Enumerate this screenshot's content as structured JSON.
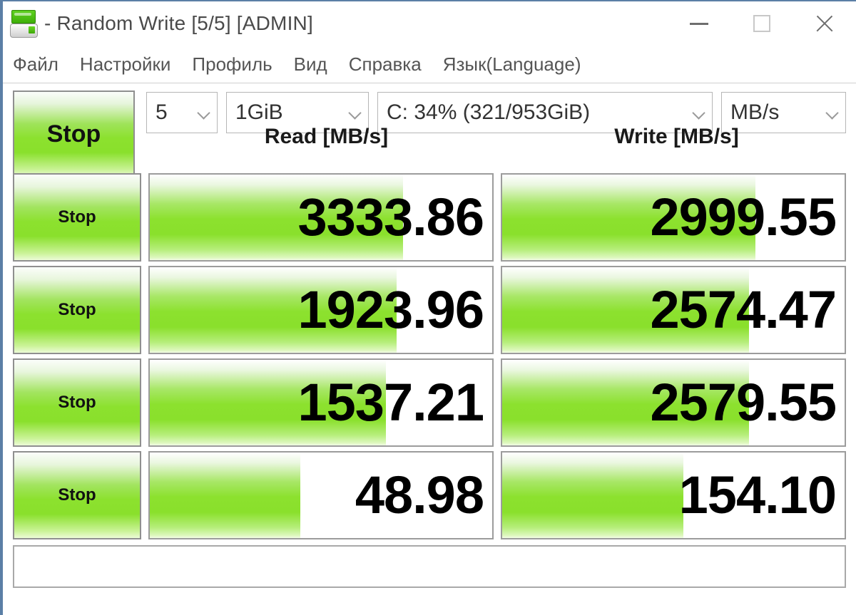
{
  "window": {
    "title": "- Random Write [5/5] [ADMIN]",
    "icon": "crystaldiskmark-icon",
    "controls": {
      "minimize": "minimize-icon",
      "maximize": "maximize-icon",
      "close": "close-icon"
    }
  },
  "menu": {
    "items": [
      {
        "label": "Файл"
      },
      {
        "label": "Настройки"
      },
      {
        "label": "Профиль"
      },
      {
        "label": "Вид"
      },
      {
        "label": "Справка"
      },
      {
        "label": "Язык(Language)"
      }
    ]
  },
  "toolbar": {
    "all_button_label": "Stop",
    "combos": {
      "count": "5",
      "size": "1GiB",
      "drive": "C: 34% (321/953GiB)",
      "unit": "MB/s"
    }
  },
  "columns": {
    "read_header": "Read [MB/s]",
    "write_header": "Write [MB/s]"
  },
  "rows": [
    {
      "button": "Stop",
      "read": "3333.86",
      "write": "2999.55",
      "read_fill_pct": 74,
      "write_fill_pct": 74
    },
    {
      "button": "Stop",
      "read": "1923.96",
      "write": "2574.47",
      "read_fill_pct": 72,
      "write_fill_pct": 72
    },
    {
      "button": "Stop",
      "read": "1537.21",
      "write": "2579.55",
      "read_fill_pct": 69,
      "write_fill_pct": 72
    },
    {
      "button": "Stop",
      "read": "48.98",
      "write": "154.10",
      "read_fill_pct": 44,
      "write_fill_pct": 53
    }
  ],
  "status": {
    "text": ""
  },
  "colors": {
    "accent_green": "#8ce12e",
    "green_dark": "#3fb009",
    "window_border": "#5b7fa6",
    "text": "#333333"
  }
}
